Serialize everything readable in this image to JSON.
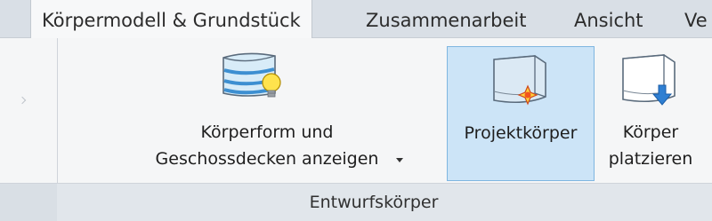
{
  "tabs": [
    {
      "label": "Körpermodell & Grundstück",
      "active": true
    },
    {
      "label": "Zusammenarbeit",
      "active": false
    },
    {
      "label": "Ansicht",
      "active": false
    },
    {
      "label": "Ve",
      "active": false
    }
  ],
  "panel": {
    "label": "Entwurfskörper",
    "buttons": [
      {
        "line1": "Körperform und",
        "line2": "Geschossdecken anzeigen",
        "icon": "show-mass-icon",
        "has_dropdown": true
      },
      {
        "line1": "Projektkörper",
        "line2": "",
        "icon": "in-place-mass-icon",
        "selected": true
      },
      {
        "line1": "Körper",
        "line2": "platzieren",
        "icon": "place-mass-icon"
      }
    ]
  },
  "colors": {
    "selected_bg": "#cce4f7",
    "selected_border": "#7fb6e0",
    "tabstrip_bg": "#d9dfe6"
  }
}
